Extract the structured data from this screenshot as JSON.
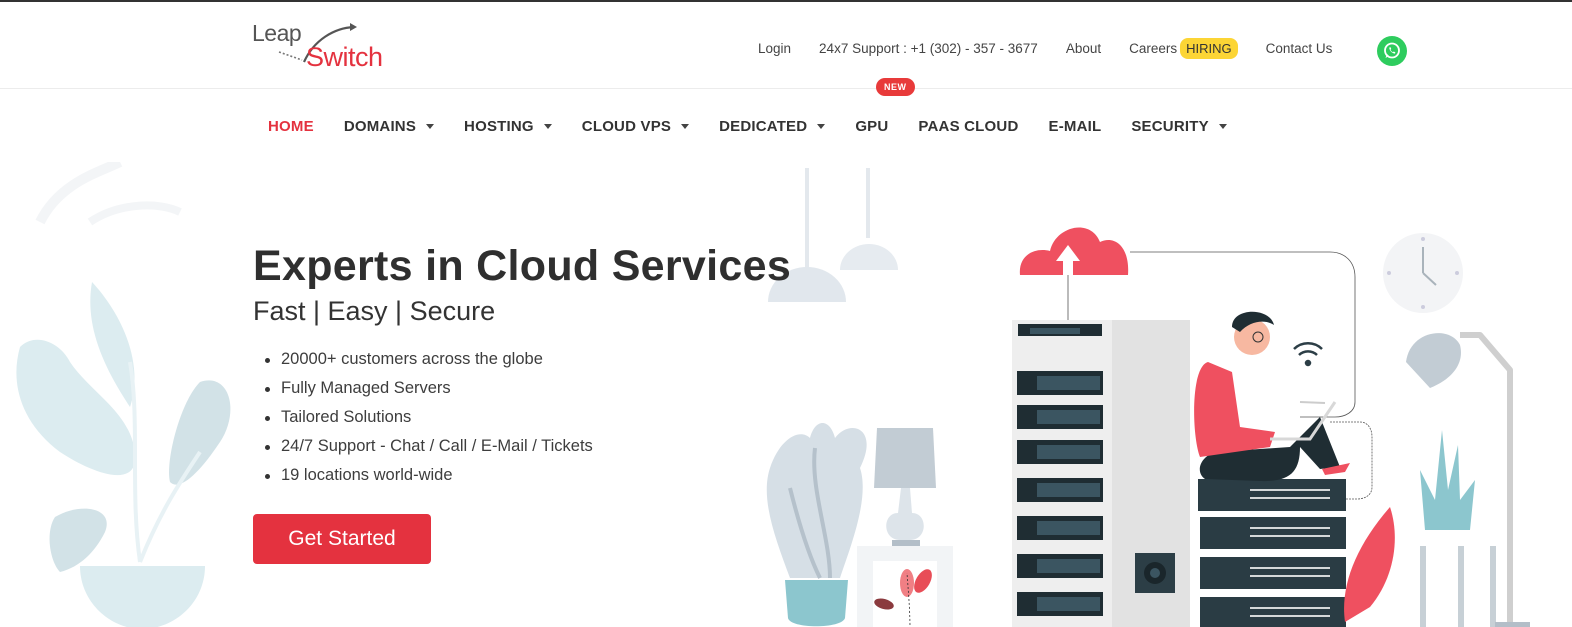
{
  "brand": {
    "line1": "Leap",
    "line2": "Switch"
  },
  "top_links": {
    "login": "Login",
    "support": "24x7 Support : +1 (302) - 357 - 3677",
    "about": "About",
    "careers": "Careers",
    "hiring_badge": "HIRING",
    "contact": "Contact Us",
    "whatsapp_icon": "whatsapp-icon"
  },
  "nav": {
    "items": [
      {
        "label": "HOME",
        "active": true,
        "dropdown": false
      },
      {
        "label": "DOMAINS",
        "dropdown": true
      },
      {
        "label": "HOSTING",
        "dropdown": true
      },
      {
        "label": "CLOUD VPS",
        "dropdown": true
      },
      {
        "label": "DEDICATED",
        "dropdown": true
      },
      {
        "label": "GPU",
        "dropdown": false,
        "badge": "NEW"
      },
      {
        "label": "PAAS CLOUD",
        "dropdown": false
      },
      {
        "label": "E-MAIL",
        "dropdown": false
      },
      {
        "label": "SECURITY",
        "dropdown": true
      }
    ]
  },
  "hero": {
    "title": "Experts in Cloud Services",
    "subtitle": "Fast | Easy | Secure",
    "features": [
      "20000+ customers across the globe",
      "Fully Managed Servers",
      "Tailored Solutions",
      "24/7 Support - Chat / Call / E-Mail / Tickets",
      "19 locations world-wide"
    ],
    "cta_label": "Get Started"
  },
  "colors": {
    "brand_red": "#e4323f",
    "hiring_yellow": "#fcd535",
    "whatsapp_green": "#2ecc5e",
    "text_dark": "#2f2f2f"
  }
}
